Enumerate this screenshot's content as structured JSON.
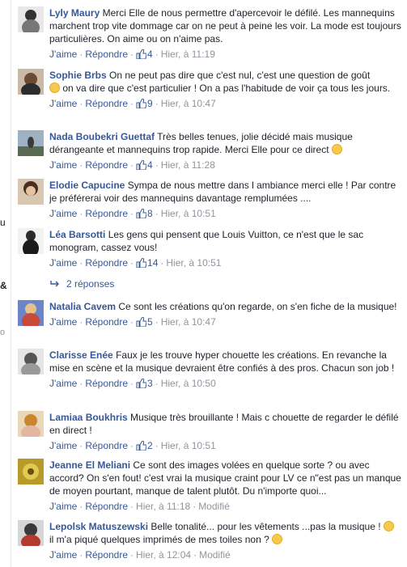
{
  "actions": {
    "like": "J'aime",
    "reply": "Répondre",
    "edited": "Modifié",
    "separator": "·"
  },
  "edge": {
    "chars": [
      "u",
      "&",
      "o"
    ]
  },
  "comments": [
    {
      "author": "Lyly Maury",
      "text": "Merci Elle de nous permettre d'apercevoir le défilé. Les mannequins marchent trop vite dommage car on ne peut à peine les voir. La mode est toujours particulières. On aime ou on n'aime pas.",
      "likes": "4",
      "time": "Hier, à 11:19",
      "emoji": false
    },
    {
      "author": "Sophie Brbs",
      "text_a": "On ne peut pas dire que c'est nul, c'est une question de goût",
      "text_b": "on va dire que c'est particulier ! On a pas l'habitude de voir ça tous les jours.",
      "likes": "9",
      "time": "Hier, à 10:47"
    },
    {
      "author": "Nada Boubekri Guettaf",
      "text": "Très belles tenues, jolie décidé mais musique dérangeante et mannequins trop rapide. Merci Elle pour ce direct",
      "likes": "4",
      "time": "Hier, à 11:28"
    },
    {
      "author": "Elodie Capucine",
      "text": "Sympa de nous mettre dans l ambiance merci elle ! Par contre je préférerai voir des mannequins davantage remplumées ....",
      "likes": "8",
      "time": "Hier, à 10:51"
    },
    {
      "author": "Léa Barsotti",
      "text": "Les gens qui pensent que Louis Vuitton, ce n'est que le sac monogram, cassez vous!",
      "likes": "14",
      "time": "Hier, à 10:51"
    },
    {
      "author": "Natalia Cavem",
      "text": "Ce sont les créations qu'on regarde, on s'en fiche de la musique!",
      "likes": "5",
      "time": "Hier, à 10:47"
    },
    {
      "author": "Clarisse Enée",
      "text": "Faux je les trouve hyper chouette les créations. En revanche la mise en scène et la musique devraient être confiés à des pros. Chacun son job !",
      "likes": "3",
      "time": "Hier, à 10:50"
    },
    {
      "author": "Lamiaa Boukhris",
      "text": "Musique très brouillante ! Mais c chouette de regarder le défilé en direct !",
      "likes": "2",
      "time": "Hier, à 10:51"
    },
    {
      "author": "Jeanne El Meliani",
      "text": "Ce sont des images volées en quelque sorte ? ou avec accord? On s'en fout! c'est vrai la musique craint pour LV ce n\"est pas un manque de moyen pourtant, manque de talent plutôt. Du n'importe quoi...",
      "time": "Hier, à 11:18"
    },
    {
      "author": "Lepolsk Matuszewski",
      "text_a": "Belle tonalité... pour les vêtements ...pas la musique !",
      "text_b": "il m'a piqué quelques imprimés de mes toiles non ?",
      "time": "Hier, à 12:04"
    }
  ],
  "replies_link": "2 réponses"
}
